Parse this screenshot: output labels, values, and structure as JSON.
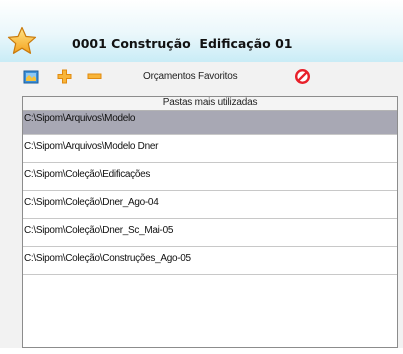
{
  "header": {
    "title": "0001 Construção  Edificação 01",
    "icon": "star-icon"
  },
  "toolbar": {
    "buttons": [
      {
        "name": "open-folder-icon",
        "color": "#3b8fd8"
      },
      {
        "name": "add-icon",
        "color": "#f5a623"
      },
      {
        "name": "remove-icon",
        "color": "#f5a623"
      },
      {
        "name": "cancel-icon",
        "color": "#e8202a"
      }
    ],
    "label": "Orçamentos Favoritos"
  },
  "panel": {
    "header": "Pastas mais utilizadas",
    "items": [
      {
        "label": "C:\\Sipom\\Arquivos\\Modelo",
        "selected": true
      },
      {
        "label": "C:\\Sipom\\Arquivos\\Modelo Dner",
        "selected": false
      },
      {
        "label": "C:\\Sipom\\Coleção\\Edificações",
        "selected": false
      },
      {
        "label": "C:\\Sipom\\Coleção\\Dner_Ago-04",
        "selected": false
      },
      {
        "label": "C:\\Sipom\\Coleção\\Dner_Sc_Mai-05",
        "selected": false
      },
      {
        "label": "C:\\Sipom\\Coleção\\Construções_Ago-05",
        "selected": false
      }
    ]
  },
  "colors": {
    "selection": "#a8a8b4",
    "header_gradient_end": "#c9ecf6"
  }
}
